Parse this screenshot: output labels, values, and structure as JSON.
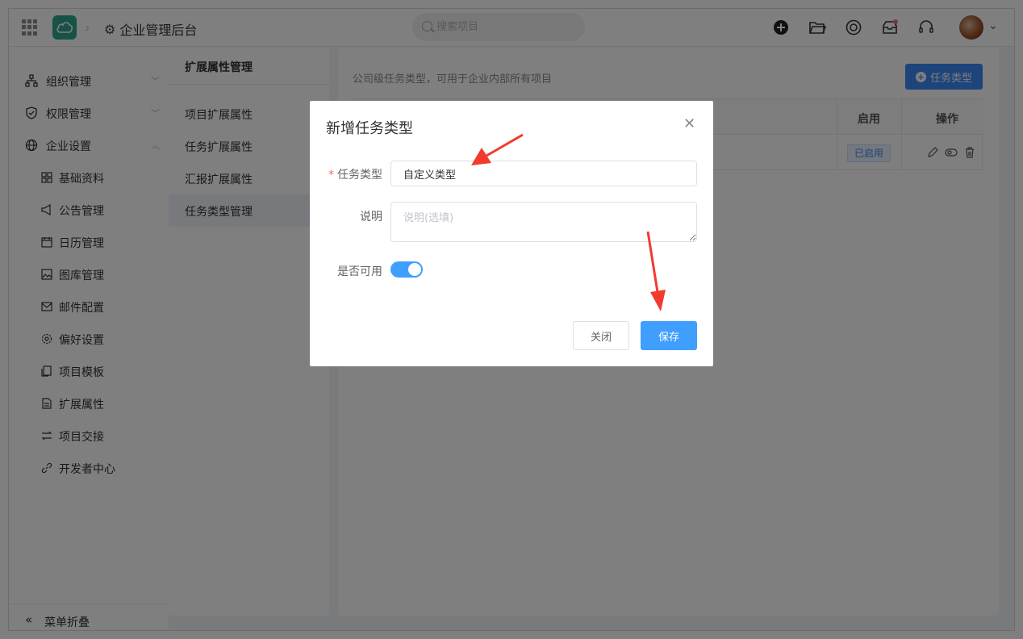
{
  "header": {
    "app_title": "企业管理后台",
    "search_placeholder": "搜索项目",
    "icons": [
      "add-circle-icon",
      "folder-icon",
      "help-ring-icon",
      "inbox-icon",
      "headset-icon"
    ]
  },
  "sidebar": {
    "groups": [
      {
        "label": "组织管理",
        "icon": "org-chart-icon",
        "expanded": false
      },
      {
        "label": "权限管理",
        "icon": "shield-icon",
        "expanded": false
      },
      {
        "label": "企业设置",
        "icon": "globe-icon",
        "expanded": true
      }
    ],
    "items": [
      {
        "label": "基础资料",
        "icon": "grid-icon"
      },
      {
        "label": "公告管理",
        "icon": "megaphone-icon"
      },
      {
        "label": "日历管理",
        "icon": "calendar-icon"
      },
      {
        "label": "图库管理",
        "icon": "image-icon"
      },
      {
        "label": "邮件配置",
        "icon": "mail-icon"
      },
      {
        "label": "偏好设置",
        "icon": "gear-icon"
      },
      {
        "label": "项目模板",
        "icon": "copy-icon"
      },
      {
        "label": "扩展属性",
        "icon": "document-icon"
      },
      {
        "label": "项目交接",
        "icon": "swap-icon"
      },
      {
        "label": "开发者中心",
        "icon": "link-icon"
      }
    ],
    "collapse_label": "菜单折叠"
  },
  "ext_panel": {
    "title": "扩展属性管理",
    "items": [
      "项目扩展属性",
      "任务扩展属性",
      "汇报扩展属性",
      "任务类型管理"
    ],
    "active_index": 3
  },
  "main": {
    "description": "公司级任务类型，可用于企业内部所有项目",
    "add_button": "任务类型",
    "table": {
      "headers": {
        "enabled": "启用",
        "actions": "操作"
      },
      "rows": [
        {
          "status": "已启用"
        }
      ]
    }
  },
  "dialog": {
    "title": "新增任务类型",
    "type_label": "任务类型",
    "type_value": "自定义类型",
    "desc_label": "说明",
    "desc_placeholder": "说明(选填)",
    "enabled_label": "是否可用",
    "enabled": true,
    "close_button": "关闭",
    "save_button": "保存"
  },
  "colors": {
    "primary": "#409eff",
    "brand": "#2fa58e",
    "annotation_arrow": "#f23a2f"
  }
}
